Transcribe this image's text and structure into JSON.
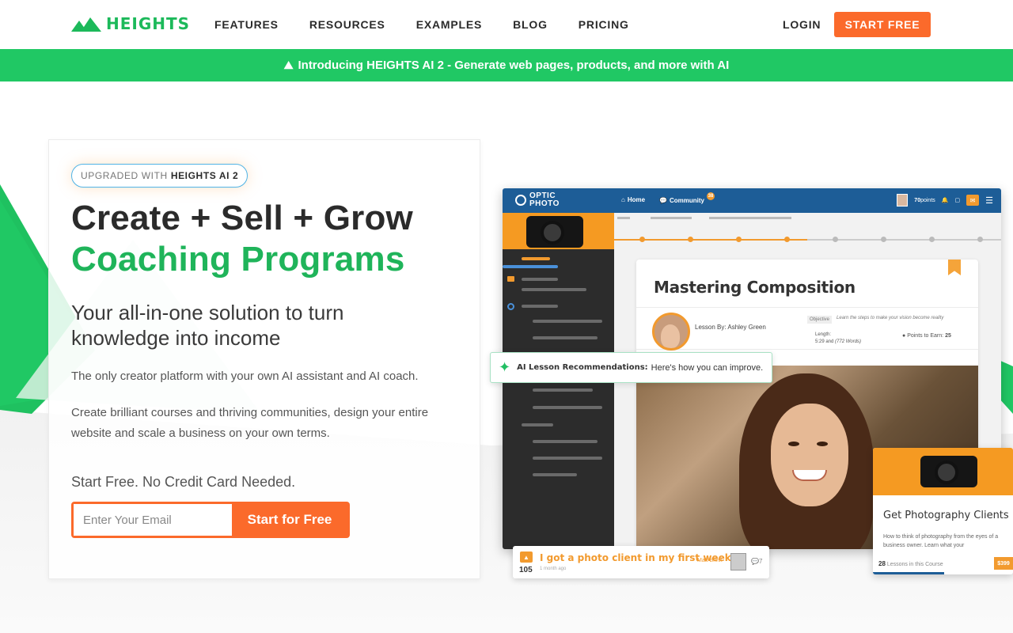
{
  "header": {
    "brand": "HEIGHTS",
    "nav": [
      "FEATURES",
      "RESOURCES",
      "EXAMPLES",
      "BLOG",
      "PRICING"
    ],
    "login": "LOGIN",
    "cta": "START FREE"
  },
  "banner": {
    "icon": "mountain-icon",
    "text": "Introducing HEIGHTS AI 2 - Generate web pages, products, and more with AI"
  },
  "hero": {
    "pill_prefix": "UPGRADED WITH",
    "pill_strong": "HEIGHTS AI 2",
    "headline_line1": "Create + Sell + Grow",
    "headline_line2": "Coaching Programs",
    "subhead": "Your all-in-one solution to turn knowledge into income",
    "para1": "The only creator platform with your own AI assistant and AI coach.",
    "para2": "Create brilliant courses and thriving communities, design your entire website and scale a business on your own terms.",
    "cc_note": "Start Free. No Credit Card Needed.",
    "email_placeholder": "Enter Your Email",
    "email_value": "",
    "signup_button": "Start for Free"
  },
  "mockup": {
    "brand_line1": "OPTIC",
    "brand_line2": "PHOTO",
    "nav_home": "Home",
    "nav_community": "Community",
    "community_badge": "38",
    "points": "70",
    "points_label": "points",
    "lesson_title": "Mastering Composition",
    "lesson_by": "Lesson By: Ashley Green",
    "objective_tag": "Objective",
    "objective_text": "Learn the steps to make your vision become reality",
    "length_label": "Length:",
    "length_value": "5:29 and",
    "length_words": "(772 Words)",
    "points_to_earn": "Points to Earn:",
    "points_to_earn_value": "25",
    "ai_title": "AI Lesson Recommendations:",
    "ai_text": "Here's how you can improve.",
    "course_title": "Get Photography Clients",
    "course_desc": "How to think of photography from the eyes of a business owner. Learn what your",
    "course_lessons": "28",
    "course_lessons_label": "Lessons in this Course",
    "course_price": "$399",
    "post_title": "I got a photo client in my first week!",
    "post_votes": "105",
    "post_ago": "1 month ago",
    "post_author": "Matt Brink",
    "post_comments": "7"
  },
  "colors": {
    "brand_green": "#1fb45a",
    "banner_green": "#20c864",
    "accent_orange": "#fb6a2b",
    "app_blue": "#1d5d97"
  }
}
